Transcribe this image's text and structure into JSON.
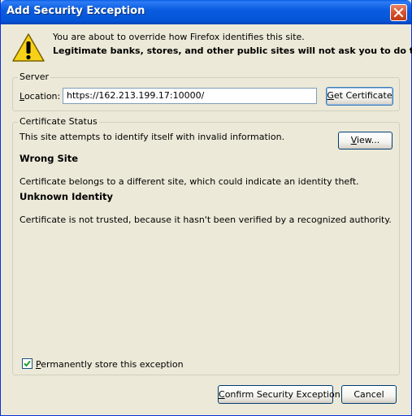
{
  "window": {
    "title": "Add Security Exception",
    "close_icon": "close-icon"
  },
  "intro": {
    "icon": "warning-icon",
    "line1": "You are about to override how Firefox identifies this site.",
    "line2": "Legitimate banks, stores, and other public sites will not ask you to do this."
  },
  "server": {
    "group_label": "Server",
    "location_label": "Location:",
    "location_value": "https://162.213.199.17:10000/",
    "get_certificate_label": "Get Certificate"
  },
  "status": {
    "group_label": "Certificate Status",
    "summary": "This site attempts to identify itself with invalid information.",
    "view_label": "View...",
    "wrong_site_heading": "Wrong Site",
    "wrong_site_text": "Certificate belongs to a different site, which could indicate an identity theft.",
    "unknown_identity_heading": "Unknown Identity",
    "unknown_identity_text": "Certificate is not trusted, because it hasn't been verified by a recognized authority.",
    "permanent_store_label": "Permanently store this exception",
    "permanent_store_checked": true
  },
  "buttons": {
    "confirm_label": "Confirm Security Exception",
    "cancel_label": "Cancel"
  },
  "colors": {
    "titlebar": "#0554d6",
    "dialog_bg": "#ece9d8",
    "close_button": "#d8512b",
    "warning_yellow": "#f7d117"
  }
}
